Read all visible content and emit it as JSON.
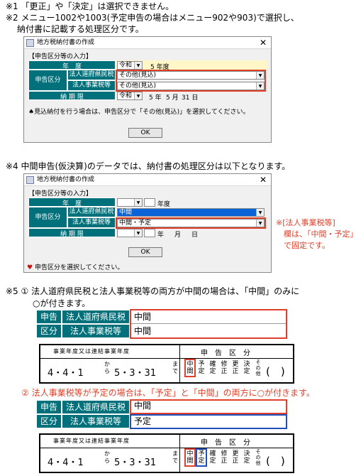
{
  "notes": {
    "n1": "※1 「更正」や「決定」は選択できません。",
    "n2a": "※2 メニュー1002や1003(予定申告の場合はメニュー902や903)で選択し、",
    "n2b": "納付書に記載する処理区分です。",
    "n4": "※4 中間申告(仮決算)のデータでは、納付書の処理区分は以下となります。",
    "n5a": "※5 ① 法人道府県民税と法人事業税等の両方が中間の場合は、「中間」のみに",
    "n5b": "○が付きます。",
    "n5c": "② 法人事業税等が予定の場合は、「予定」と「中間」の両方に○が付きます。",
    "side": [
      "※[法人事業税等]",
      "欄は、「中間・予定」",
      "で固定です。"
    ]
  },
  "dialog1": {
    "title": "地方税納付書の作成",
    "section": "【申告区分等の入力】",
    "year_label": "年　度",
    "era": "令和",
    "year_value": "5 年度",
    "kubun_label": "申告区分",
    "pref_label": "法人道府県民税",
    "pref_value": "その他(見込)",
    "biz_label": "法人事業税等",
    "biz_value": "その他(見込)",
    "deadline_label": "納 期 限",
    "deadline_era": "令和",
    "deadline_y": "5 年",
    "deadline_m": "5 月",
    "deadline_d": "31 日",
    "hint": "見込納付を行う場合は、申告区分で「その他(見込)」を選択してください。",
    "ok": "OK",
    "close": "✕"
  },
  "dialog2": {
    "title": "地方税納付書の作成",
    "section": "【申告区分等の入力】",
    "year_label": "年　度",
    "year_suffix": "年度",
    "kubun_label": "申告区分",
    "pref_label": "法人道府県民税",
    "pref_value": "中間",
    "biz_label": "法人事業税等",
    "biz_value": "中間・予定",
    "deadline_label": "納 期 限",
    "y": "年",
    "m": "月",
    "d": "日",
    "ok": "OK",
    "status": "申告区分を選択してください。",
    "close": "✕"
  },
  "table1": {
    "h1": "申告",
    "h2": "区分",
    "pref_label": "法人道府県民税",
    "pref_value": "中間",
    "biz_label": "法人事業税等",
    "biz_value": "中間"
  },
  "table2": {
    "h1": "申告",
    "h2": "区分",
    "pref_label": "法人道府県民税",
    "pref_value": "中間",
    "biz_label": "法人事業税等",
    "biz_value": "予定"
  },
  "form": {
    "header_left": "事業年度又は連結事業年度",
    "header_right": "申　告　区　分",
    "from": "4・4・1",
    "kara": "から",
    "to": "5・3・31",
    "made": "まで",
    "kinds": [
      "中間",
      "予定",
      "確定",
      "修正",
      "更正",
      "決定",
      "その他"
    ],
    "paren": "(　)"
  },
  "colors": {
    "teal": "#00707a",
    "red": "#e0402a",
    "blue": "#1f4fb8"
  }
}
